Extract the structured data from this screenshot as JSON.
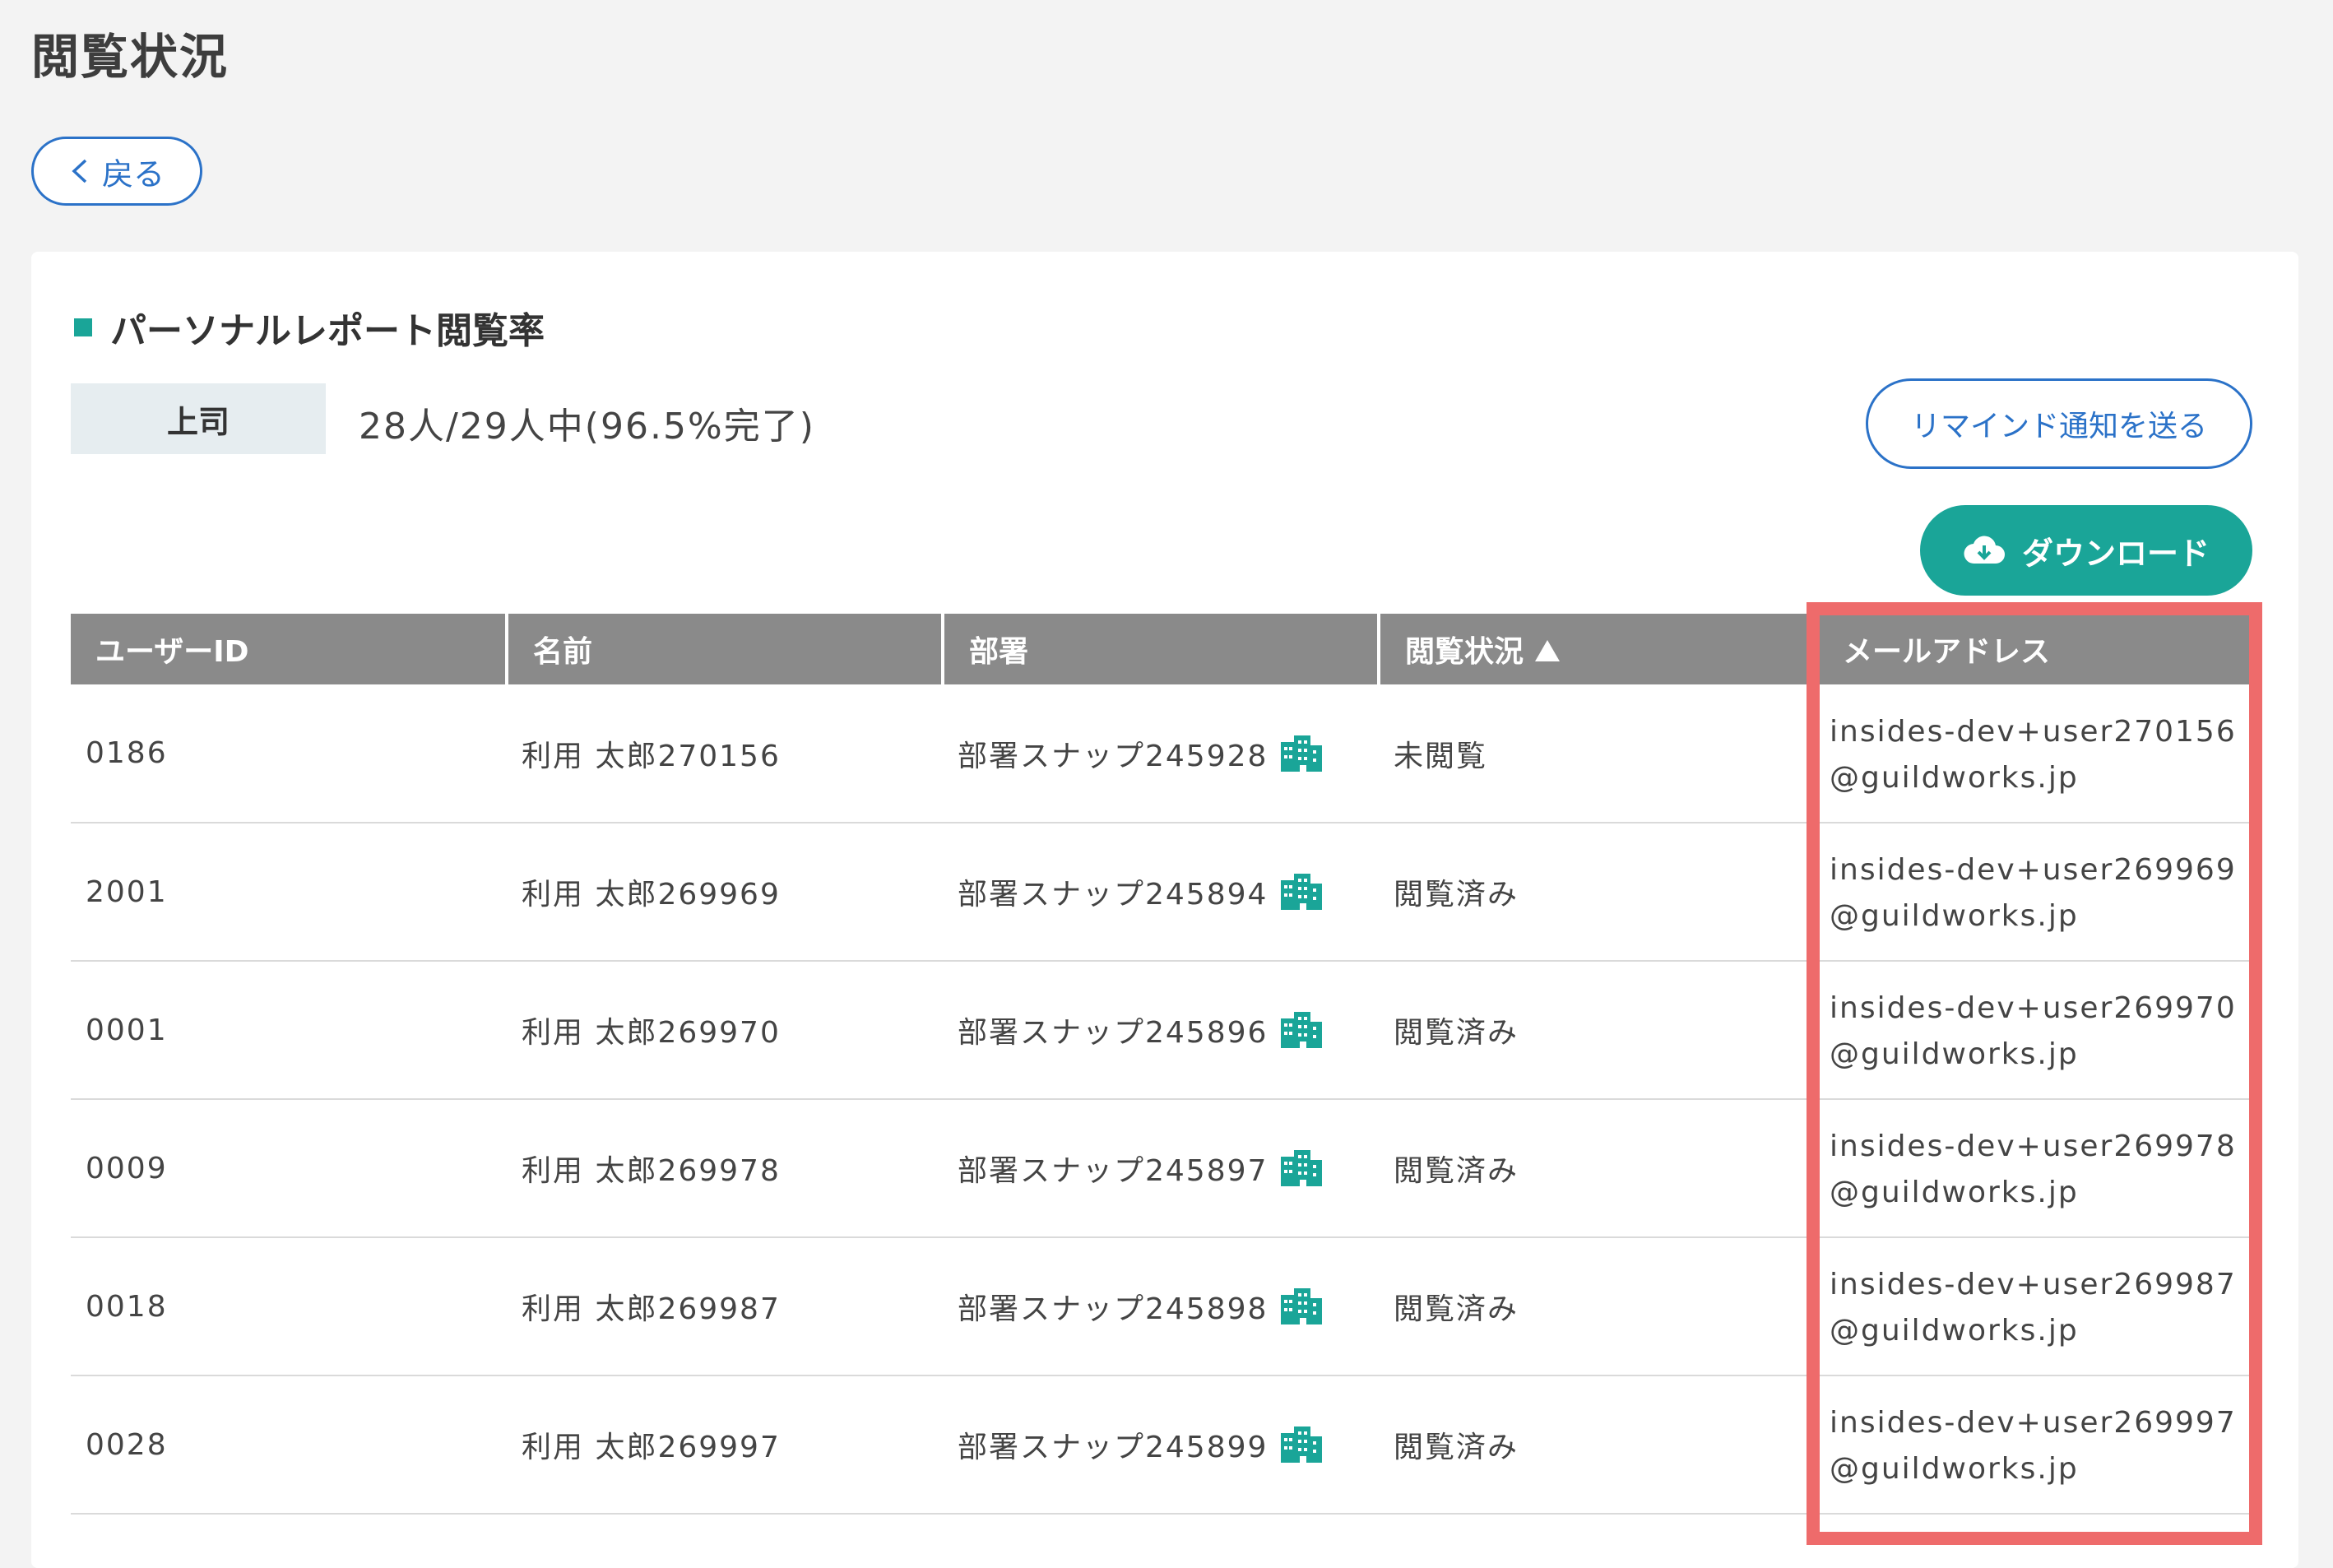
{
  "page": {
    "title": "閲覧状況"
  },
  "back_button": {
    "label": "戻る"
  },
  "section": {
    "title": "パーソナルレポート閲覧率"
  },
  "summary": {
    "role": "上司",
    "rate": "28人/29人中(96.5%完了)"
  },
  "actions": {
    "remind_label": "リマインド通知を送る",
    "download_label": "ダウンロード"
  },
  "table": {
    "headers": {
      "user_id": "ユーザーID",
      "name": "名前",
      "department": "部署",
      "status": "閲覧状況",
      "email": "メールアドレス"
    },
    "rows": [
      {
        "user_id": "0186",
        "name": "利用 太郎270156",
        "department": "部署スナップ245928",
        "status": "未閲覧",
        "email_local": "insides-dev+user270156",
        "email_domain": "@guildworks.jp"
      },
      {
        "user_id": "2001",
        "name": "利用 太郎269969",
        "department": "部署スナップ245894",
        "status": "閲覧済み",
        "email_local": "insides-dev+user269969",
        "email_domain": "@guildworks.jp"
      },
      {
        "user_id": "0001",
        "name": "利用 太郎269970",
        "department": "部署スナップ245896",
        "status": "閲覧済み",
        "email_local": "insides-dev+user269970",
        "email_domain": "@guildworks.jp"
      },
      {
        "user_id": "0009",
        "name": "利用 太郎269978",
        "department": "部署スナップ245897",
        "status": "閲覧済み",
        "email_local": "insides-dev+user269978",
        "email_domain": "@guildworks.jp"
      },
      {
        "user_id": "0018",
        "name": "利用 太郎269987",
        "department": "部署スナップ245898",
        "status": "閲覧済み",
        "email_local": "insides-dev+user269987",
        "email_domain": "@guildworks.jp"
      },
      {
        "user_id": "0028",
        "name": "利用 太郎269997",
        "department": "部署スナップ245899",
        "status": "閲覧済み",
        "email_local": "insides-dev+user269997",
        "email_domain": "@guildworks.jp"
      }
    ]
  },
  "icons": {
    "back": "chevron-left-icon",
    "download": "cloud-download-icon",
    "department": "building-icon",
    "sort": "sort-ascending-icon"
  },
  "colors": {
    "accent": "#1aa598",
    "link": "#2b72c8",
    "header_bg": "#8a8a8a",
    "highlight": "#ee6b6b"
  }
}
